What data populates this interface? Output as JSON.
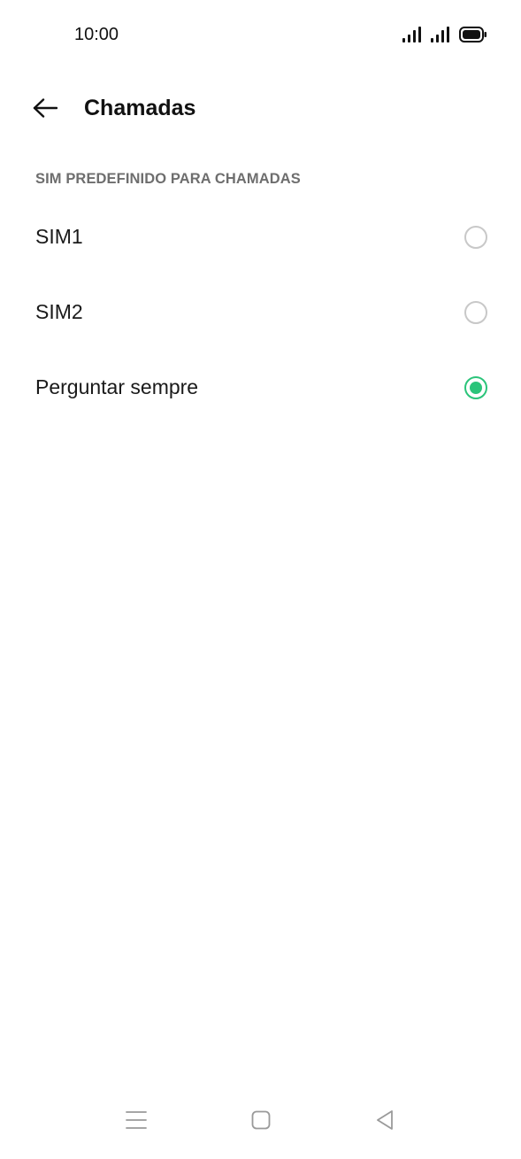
{
  "status_bar": {
    "time": "10:00",
    "icons": [
      "signal-icon",
      "signal-icon",
      "battery-icon"
    ]
  },
  "app_bar": {
    "back_icon": "arrow-left-icon",
    "title": "Chamadas"
  },
  "section": {
    "header": "SIM PREDEFINIDO PARA CHAMADAS",
    "options": [
      {
        "label": "SIM1",
        "selected": false
      },
      {
        "label": "SIM2",
        "selected": false
      },
      {
        "label": "Perguntar sempre",
        "selected": true
      }
    ]
  },
  "nav_bar": {
    "icons": [
      "menu-icon",
      "home-square-icon",
      "back-triangle-icon"
    ]
  },
  "colors": {
    "accent": "#2bc47a",
    "section_header": "#6e6e6e",
    "radio_unchecked": "#c8c8c8"
  }
}
